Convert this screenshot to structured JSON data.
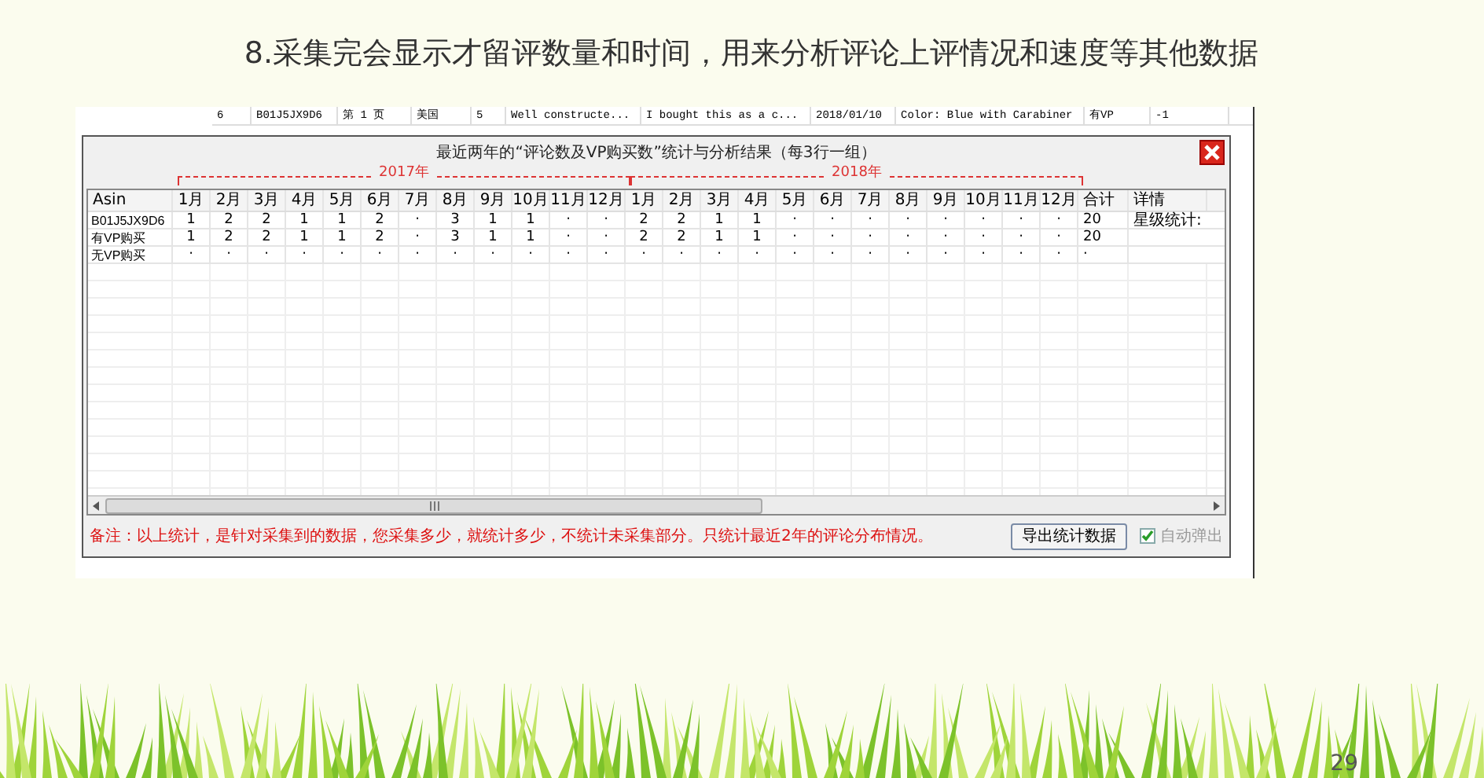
{
  "slide_title": "8.采集完会显示才留评数量和时间，用来分析评论上评情况和速度等其他数据",
  "background_table": {
    "row": [
      "6",
      "B01J5JX9D6",
      "第 1 页",
      "美国",
      "5",
      "Well constructe...",
      "I bought this as a c...",
      "2018/01/10",
      "Color: Blue with Carabiner",
      "有VP",
      "-1"
    ]
  },
  "dialog": {
    "title": "最近两年的“评论数及VP购买数”统计与分析结果（每3行一组）",
    "year_groups": [
      "2017年",
      "2018年"
    ],
    "columns": [
      "Asin",
      "1月",
      "2月",
      "3月",
      "4月",
      "5月",
      "6月",
      "7月",
      "8月",
      "9月",
      "10月",
      "11月",
      "12月",
      "1月",
      "2月",
      "3月",
      "4月",
      "5月",
      "6月",
      "7月",
      "8月",
      "9月",
      "10月",
      "11月",
      "12月",
      "合计",
      "详情"
    ],
    "rows": [
      {
        "label": "B01J5JX9D6",
        "months": [
          "1",
          "2",
          "2",
          "1",
          "1",
          "2",
          "·",
          "3",
          "1",
          "1",
          "·",
          "·",
          "2",
          "2",
          "1",
          "1",
          "·",
          "·",
          "·",
          "·",
          "·",
          "·",
          "·",
          "·"
        ],
        "total": "20",
        "detail": "星级统计:"
      },
      {
        "label": "有VP购买",
        "months": [
          "1",
          "2",
          "2",
          "1",
          "1",
          "2",
          "·",
          "3",
          "1",
          "1",
          "·",
          "·",
          "2",
          "2",
          "1",
          "1",
          "·",
          "·",
          "·",
          "·",
          "·",
          "·",
          "·",
          "·"
        ],
        "total": "20"
      },
      {
        "label": "无VP购买",
        "months": [
          "·",
          "·",
          "·",
          "·",
          "·",
          "·",
          "·",
          "·",
          "·",
          "·",
          "·",
          "·",
          "·",
          "·",
          "·",
          "·",
          "·",
          "·",
          "·",
          "·",
          "·",
          "·",
          "·",
          "·"
        ],
        "total": "·"
      }
    ],
    "note": "备注：以上统计，是针对采集到的数据，您采集多少，就统计多少，不统计未采集部分。只统计最近2年的评论分布情况。",
    "export_button": "导出统计数据",
    "auto_popup": {
      "label": "自动弹出",
      "checked": true,
      "disabled": true
    }
  },
  "page_number": "29"
}
